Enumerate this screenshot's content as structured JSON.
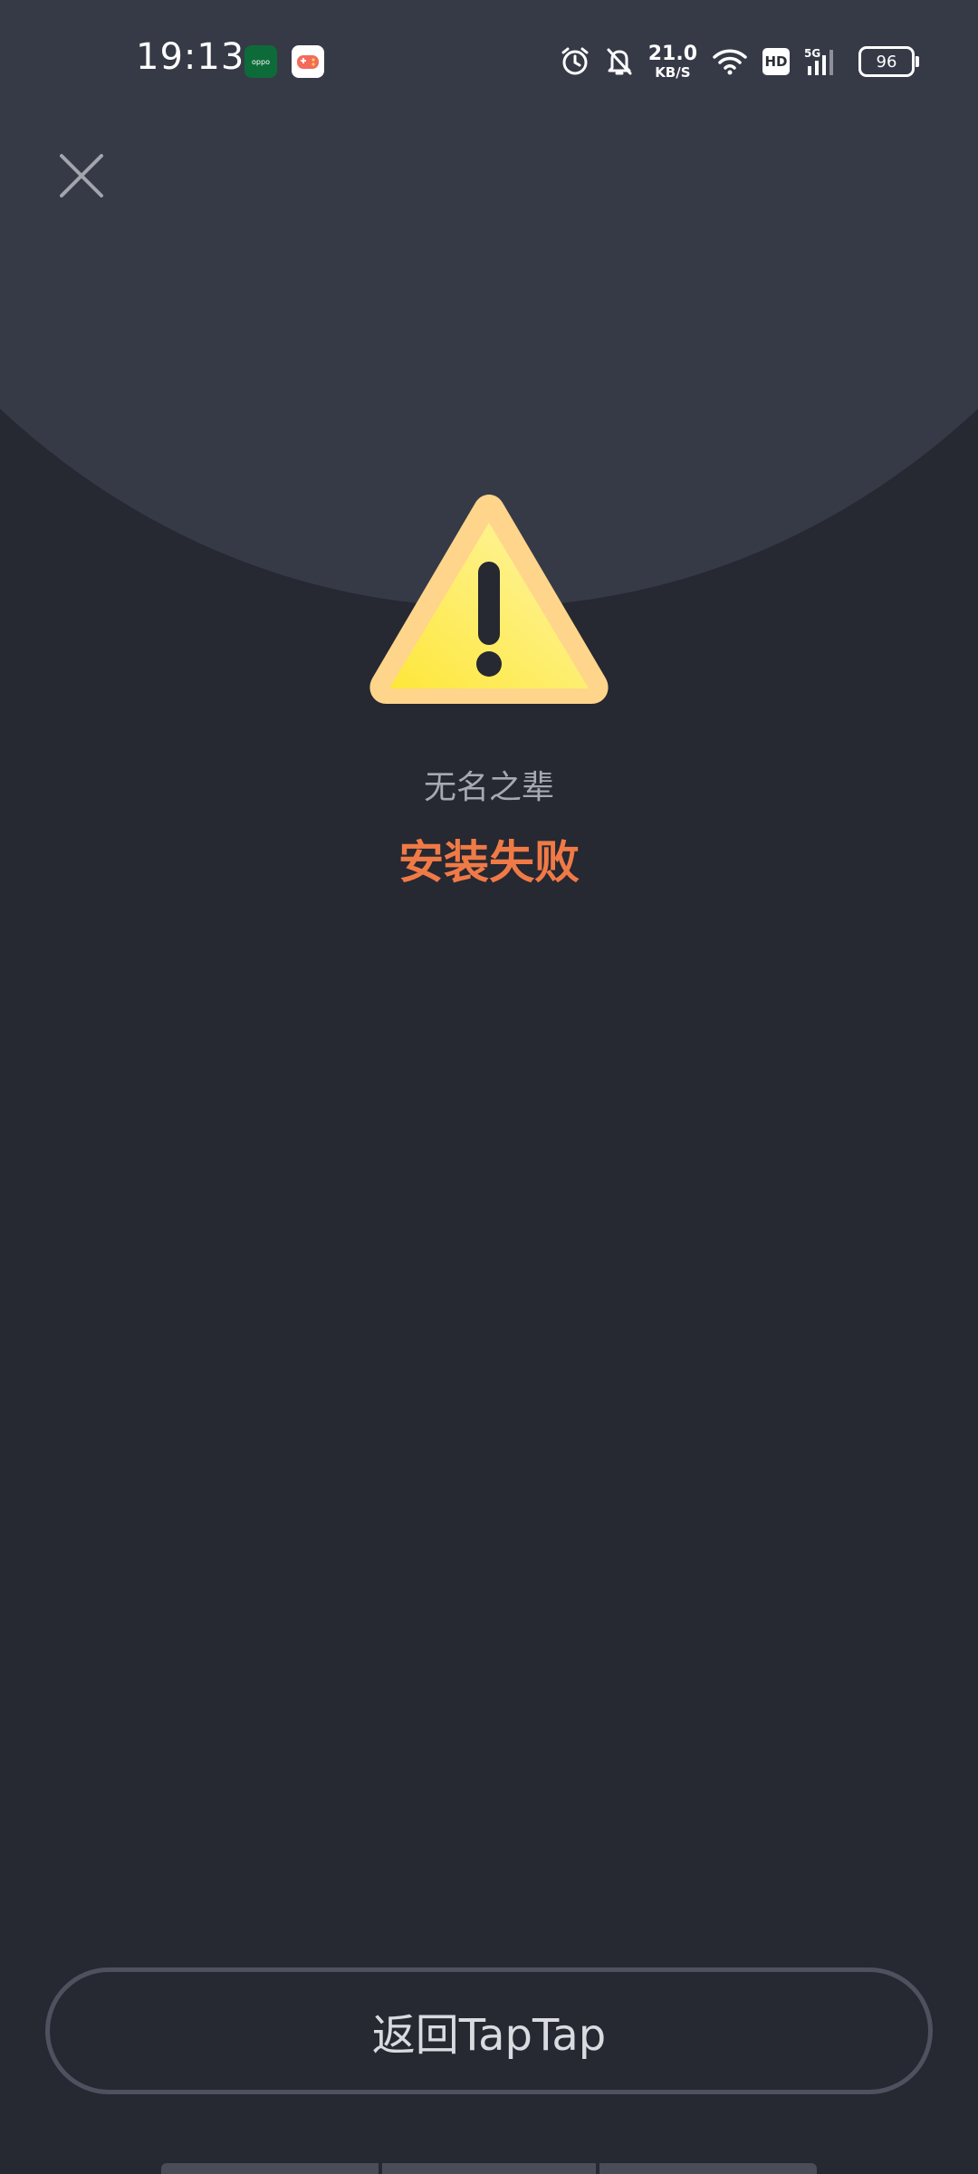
{
  "status_bar": {
    "time": "19:13",
    "oppo_icon_text": "oppo",
    "net_speed_value": "21.0",
    "net_speed_unit": "KB/S",
    "hd_label": "HD",
    "network_label": "5G",
    "battery_level": "96"
  },
  "icons": {
    "close": "close-icon",
    "warning": "warning-icon",
    "alarm": "alarm-icon",
    "mute": "bell-off-icon",
    "wifi": "wifi-icon",
    "signal": "signal-icon",
    "battery": "battery-icon"
  },
  "content": {
    "app_name": "无名之辈",
    "status": "安装失败"
  },
  "actions": {
    "return_label": "返回TapTap"
  },
  "colors": {
    "background": "#262832",
    "header": "#363a47",
    "error_accent": "#f07a46",
    "warning_yellow": "#fde65a"
  }
}
